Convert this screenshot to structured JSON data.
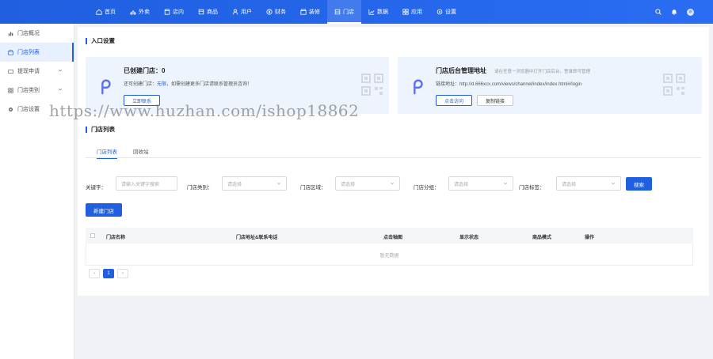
{
  "topnav": {
    "items": [
      {
        "label": "首页",
        "icon": "home-icon"
      },
      {
        "label": "外卖",
        "icon": "delivery-icon"
      },
      {
        "label": "店内",
        "icon": "store-icon"
      },
      {
        "label": "商品",
        "icon": "goods-icon"
      },
      {
        "label": "用户",
        "icon": "user-icon"
      },
      {
        "label": "财务",
        "icon": "finance-icon"
      },
      {
        "label": "装修",
        "icon": "decorate-icon"
      },
      {
        "label": "门店",
        "icon": "shop-icon"
      },
      {
        "label": "数据",
        "icon": "chart-icon"
      },
      {
        "label": "应用",
        "icon": "apps-icon"
      },
      {
        "label": "设置",
        "icon": "settings-icon"
      }
    ],
    "active_index": 7
  },
  "sidebar": {
    "items": [
      {
        "label": "门店概况"
      },
      {
        "label": "门店列表"
      },
      {
        "label": "提现申请"
      },
      {
        "label": "门店类别"
      },
      {
        "label": "门店设置"
      }
    ]
  },
  "entry": {
    "title": "入口设置",
    "card1": {
      "title": "已创建门店：0",
      "text_prefix": "还可创建门店：",
      "text_highlight": "无限",
      "text_suffix": "，如需创建更多门店请联系管理员咨询！",
      "button": "立即联系"
    },
    "card2": {
      "title": "门店后台管理地址",
      "hint": "请在任意一浏览器中打开门店后台，登录即可管理",
      "text": "链接地址：http://d.666xcx.com/views/channel/index/index.html#/login",
      "button_primary": "点击访问",
      "button_secondary": "复制链接"
    }
  },
  "list": {
    "title": "门店列表",
    "tabs": [
      "门店列表",
      "回收站"
    ],
    "filters": [
      {
        "label": "关键字：",
        "placeholder": "请输入关键字搜索"
      },
      {
        "label": "门店类别：",
        "placeholder": "请选择"
      },
      {
        "label": "门店区域：",
        "placeholder": "请选择"
      },
      {
        "label": "门店分组：",
        "placeholder": "请选择"
      },
      {
        "label": "门店标签：",
        "placeholder": "请选择"
      }
    ],
    "search_button": "搜索",
    "add_button": "新建门店",
    "columns": [
      "门店名称",
      "门店地址&联系电话",
      "点击轴图",
      "显示状态",
      "商品模式",
      "操作"
    ],
    "empty_text": "暂无数据",
    "pager": {
      "prev": "‹",
      "current": "1",
      "next": "›"
    }
  },
  "watermark": "https://www.huzhan.com/ishop18862"
}
